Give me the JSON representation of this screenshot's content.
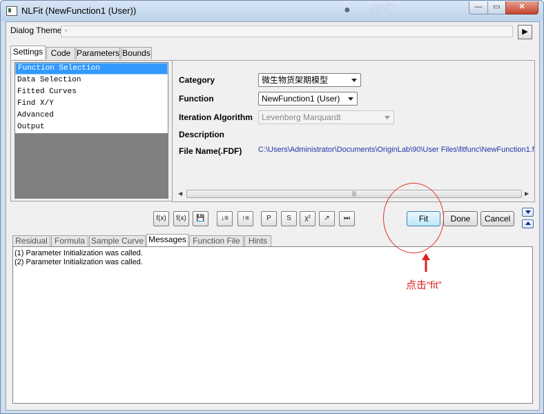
{
  "window": {
    "title": "NLFit (NewFunction1 (User))",
    "background_glyph": "●",
    "background_text": "0°C",
    "controls": {
      "minimize": "—",
      "maximize": "▭",
      "close": "✕"
    }
  },
  "theme": {
    "label": "Dialog Theme",
    "value": "*",
    "arrow": "▶"
  },
  "tabs": [
    "Settings",
    "Code",
    "Parameters",
    "Bounds"
  ],
  "tree": {
    "items": [
      "Function Selection",
      "Data Selection",
      "Fitted Curves",
      "Find X/Y",
      "Advanced",
      "Output"
    ],
    "selected_index": 0
  },
  "settings": {
    "category_label": "Category",
    "category_value": "微生物货架期模型",
    "function_label": "Function",
    "function_value": "NewFunction1 (User)",
    "iteration_label": "Iteration Algorithm",
    "iteration_value": "Levenberg Marquardt",
    "description_label": "Description",
    "filename_label": "File Name(.FDF)",
    "filename_value": "C:\\Users\\Administrator\\Documents\\OriginLab\\90\\User Files\\fitfunc\\NewFunction1.f"
  },
  "scrollbar": {
    "left": "◀",
    "right": "▶",
    "grip": "|||"
  },
  "toolbar": {
    "icons": [
      "f(x)",
      "f(x)",
      "💾",
      "↓≡",
      "↑≡",
      "P",
      "S",
      "χ²",
      "↗",
      "⏭"
    ]
  },
  "buttons": {
    "fit": "Fit",
    "done": "Done",
    "cancel": "Cancel"
  },
  "bottom_tabs": [
    "Residual",
    "Formula",
    "Sample Curve",
    "Messages",
    "Function File",
    "Hints"
  ],
  "active_bottom_tab": "Messages",
  "messages": [
    "(1) Parameter Initialization was called.",
    "(2) Parameter Initialization was called."
  ],
  "annotation": {
    "text": "点击“fit”",
    "color": "#e02020"
  },
  "colors": {
    "selection": "#3399ff",
    "path_text": "#2233aa",
    "annotation": "#e02020"
  }
}
